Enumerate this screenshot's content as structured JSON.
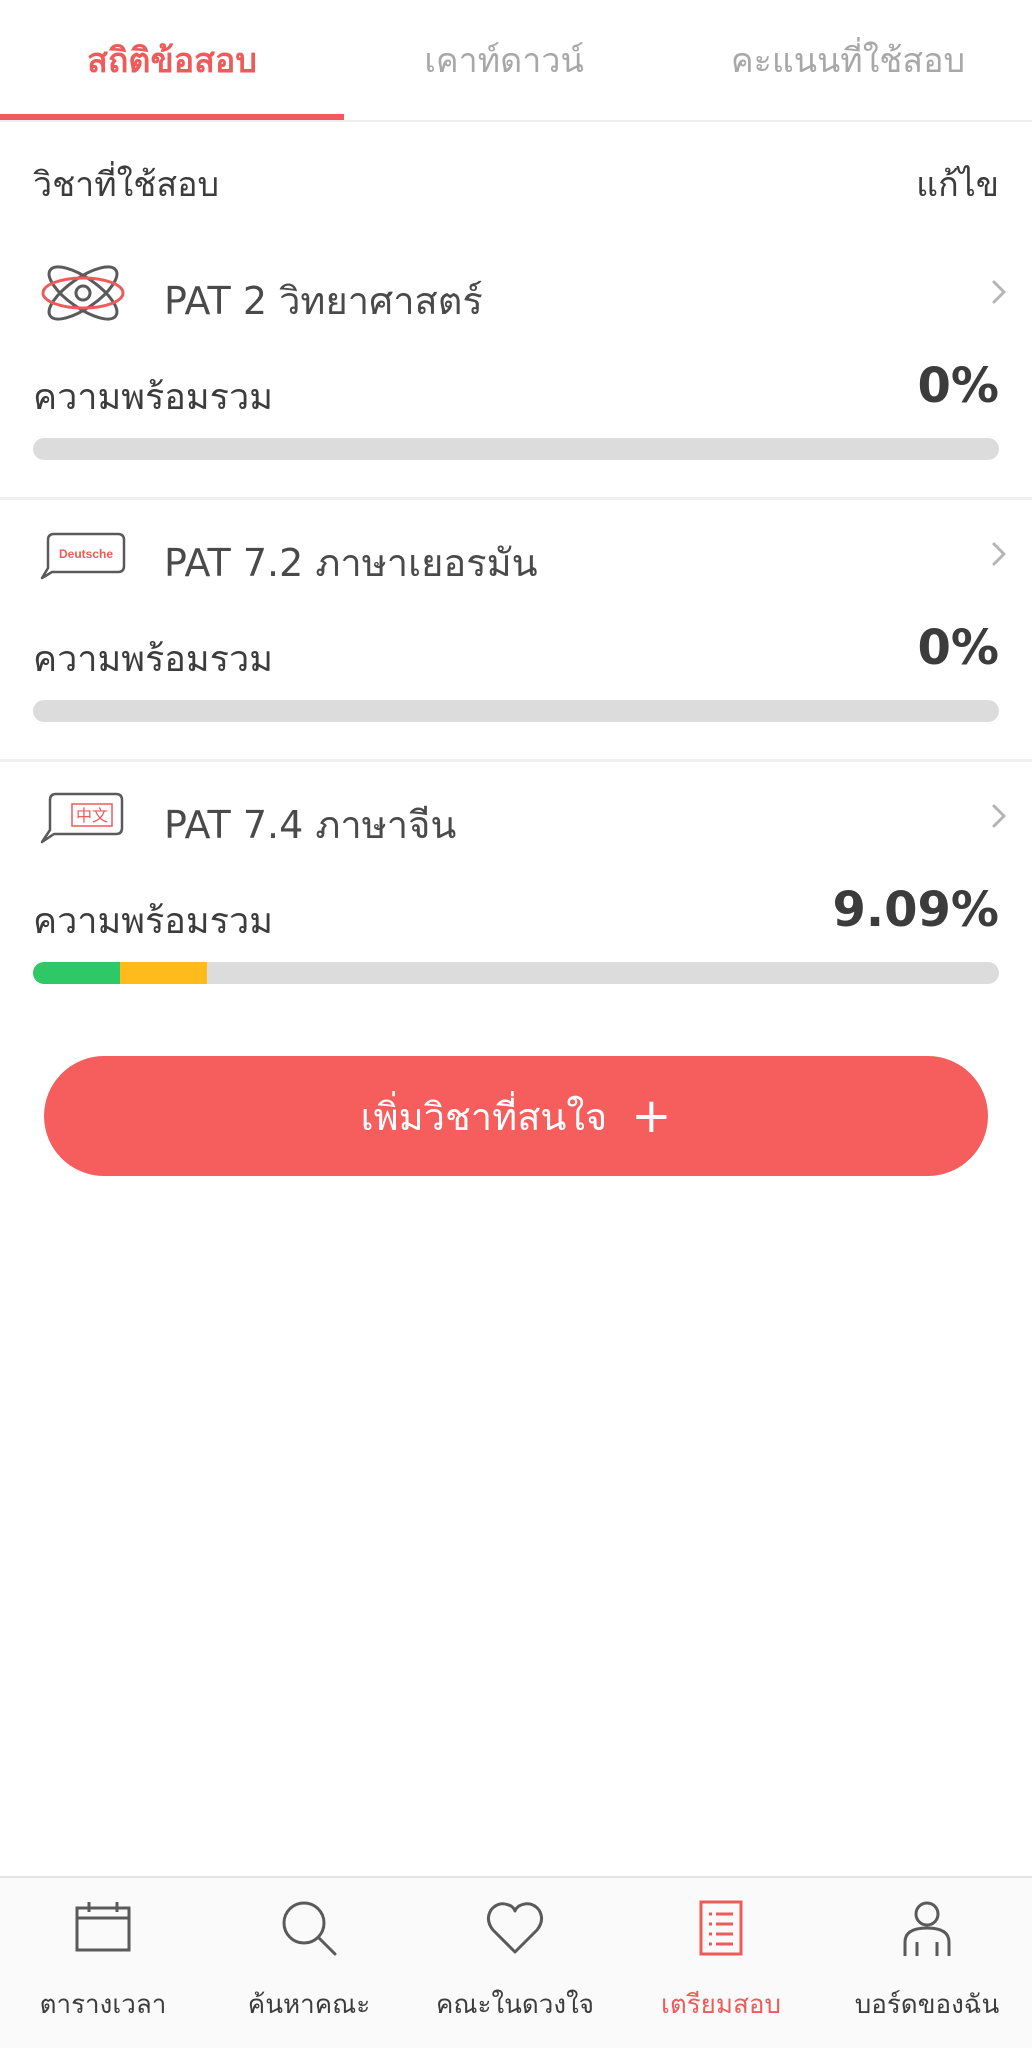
{
  "tabs": [
    {
      "label": "สถิติข้อสอบ",
      "active": true
    },
    {
      "label": "เคาท์ดาวน์",
      "active": false
    },
    {
      "label": "คะแนนที่ใช้สอบ",
      "active": false
    }
  ],
  "section": {
    "title": "วิชาที่ใช้สอบ",
    "edit_label": "แก้ไข"
  },
  "subjects": [
    {
      "name": "PAT 2 วิทยาศาสตร์",
      "icon": "atom-icon",
      "readiness_label": "ความพร้อมรวม",
      "readiness_value": "0%",
      "progress": []
    },
    {
      "name": "PAT 7.2 ภาษาเยอรมัน",
      "icon": "deutsche-speech-icon",
      "icon_text": "Deutsche",
      "readiness_label": "ความพร้อมรวม",
      "readiness_value": "0%",
      "progress": []
    },
    {
      "name": "PAT 7.4 ภาษาจีน",
      "icon": "chinese-speech-icon",
      "icon_text": "中文",
      "readiness_label": "ความพร้อมรวม",
      "readiness_value": "9.09%",
      "progress": [
        {
          "color": "#2ec866",
          "fraction": 0.09
        },
        {
          "color": "#ffbb1c",
          "fraction": 0.09
        }
      ]
    }
  ],
  "add_button": {
    "label": "เพิ่มวิชาที่สนใจ",
    "plus": "+"
  },
  "bottom_nav": [
    {
      "label": "ตารางเวลา",
      "icon": "calendar-icon",
      "active": false
    },
    {
      "label": "ค้นหาคณะ",
      "icon": "search-icon",
      "active": false
    },
    {
      "label": "คณะในดวงใจ",
      "icon": "heart-icon",
      "active": false
    },
    {
      "label": "เตรียมสอบ",
      "icon": "checklist-icon",
      "active": true
    },
    {
      "label": "บอร์ดของฉัน",
      "icon": "person-icon",
      "active": false
    }
  ],
  "colors": {
    "accent": "#ef5a5a",
    "button": "#f65e5e",
    "track": "#dcdcdc",
    "progress_green": "#2ec866",
    "progress_yellow": "#ffbb1c"
  }
}
